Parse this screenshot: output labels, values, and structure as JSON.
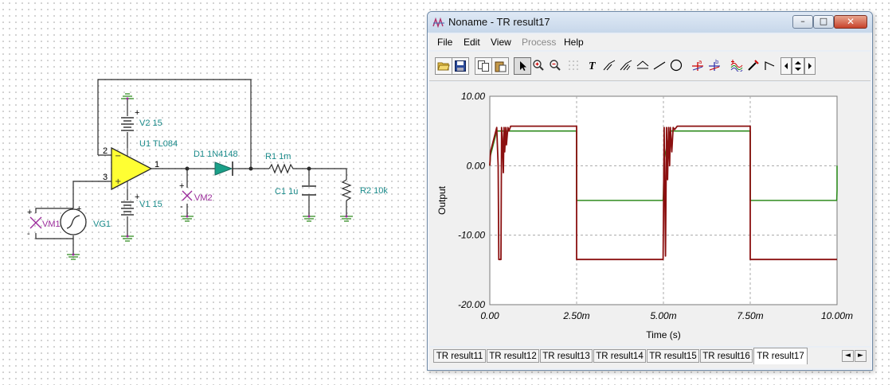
{
  "schematic": {
    "labels": {
      "v2": "V2 15",
      "u1": "U1 TL084",
      "v1": "V1 15",
      "d1": "D1 1N4148",
      "r1": "R1 1m",
      "c1": "C1 1u",
      "r2": "R2 10k",
      "vm1": "VM1",
      "vg1": "VG1",
      "vm2": "VM2",
      "pin1": "1",
      "pin2": "2",
      "pin3": "3",
      "plus": "+",
      "minus": "-"
    }
  },
  "window": {
    "title": "Noname - TR result17",
    "caption_buttons": {
      "minimize": "–",
      "maximize": "□",
      "close": "✕"
    },
    "menu": [
      {
        "label": "File",
        "enabled": true
      },
      {
        "label": "Edit",
        "enabled": true
      },
      {
        "label": "View",
        "enabled": true
      },
      {
        "label": "Process",
        "enabled": false
      },
      {
        "label": "Help",
        "enabled": true
      }
    ],
    "toolbar": {
      "icons": [
        "open-folder-icon",
        "save-icon",
        "copy-icon",
        "paste-icon",
        "pointer-icon",
        "zoom-in-icon",
        "zoom-100-icon",
        "grid-icon",
        "text-icon",
        "cursor-a-icon",
        "cursor-b-icon",
        "cursor-calc-icon",
        "line-icon",
        "circle-icon",
        "marker-a-icon",
        "marker-b-icon",
        "curve-icon",
        "probe-icon",
        "step-icon",
        "scroll-left-icon",
        "scroll-updown-icon",
        "scroll-right-icon"
      ],
      "text_tool_glyph": "T",
      "marker_a": "a",
      "marker_b": "b"
    },
    "tabs": [
      "TR result11",
      "TR result12",
      "TR result13",
      "TR result14",
      "TR result15",
      "TR result16",
      "TR result17"
    ],
    "active_tab": "TR result17",
    "tab_scroll": {
      "left": "◄",
      "right": "►"
    }
  },
  "chart_data": {
    "type": "line",
    "xlabel": "Time (s)",
    "ylabel": "Output",
    "xlim": [
      0,
      0.01
    ],
    "ylim": [
      -20,
      10
    ],
    "x_ticks": [
      0,
      0.0025,
      0.005,
      0.0075,
      0.01
    ],
    "x_tick_labels": [
      "0.00",
      "2.50m",
      "5.00m",
      "7.50m",
      "10.00m"
    ],
    "y_ticks": [
      10,
      0,
      -10,
      -20
    ],
    "y_tick_labels": [
      "10.00",
      "0.00",
      "-10.00",
      "-20.00"
    ],
    "grid": true,
    "series": [
      {
        "color": "#2e8b1e",
        "x": [
          0,
          2e-05,
          0.0002,
          0.0025,
          0.0025,
          0.00499,
          0.005,
          0.00502,
          0.0052,
          0.0075,
          0.0075,
          0.00999,
          0.01,
          0.01
        ],
        "y": [
          0,
          1.5,
          5,
          5,
          -5,
          -5,
          -4,
          1,
          5,
          5,
          -5,
          -5,
          -3.5,
          0
        ]
      },
      {
        "color": "#8b1010",
        "x": [
          0,
          2e-05,
          0.0002,
          0.00024,
          0.00026,
          0.00032,
          0.00034,
          0.00036,
          0.00039,
          0.00041,
          0.00043,
          0.00046,
          0.00048,
          0.00052,
          0.00055,
          0.0006,
          0.0025,
          0.0025,
          0.00499,
          0.00502,
          0.00506,
          0.00509,
          0.00512,
          0.00515,
          0.00518,
          0.0052,
          0.00524,
          0.00528,
          0.00532,
          0.0054,
          0.0075,
          0.0075,
          0.01
        ],
        "y": [
          0,
          2,
          5.5,
          0,
          -13.5,
          -13.5,
          5.5,
          4,
          -1,
          5.5,
          2,
          5.5,
          3,
          5.5,
          5,
          5.7,
          5.7,
          -13.5,
          -13.5,
          5.5,
          -13,
          5.5,
          -2,
          5.5,
          0,
          5.5,
          2,
          5.5,
          5.2,
          5.7,
          5.7,
          -13.5,
          -13.5
        ]
      }
    ]
  }
}
